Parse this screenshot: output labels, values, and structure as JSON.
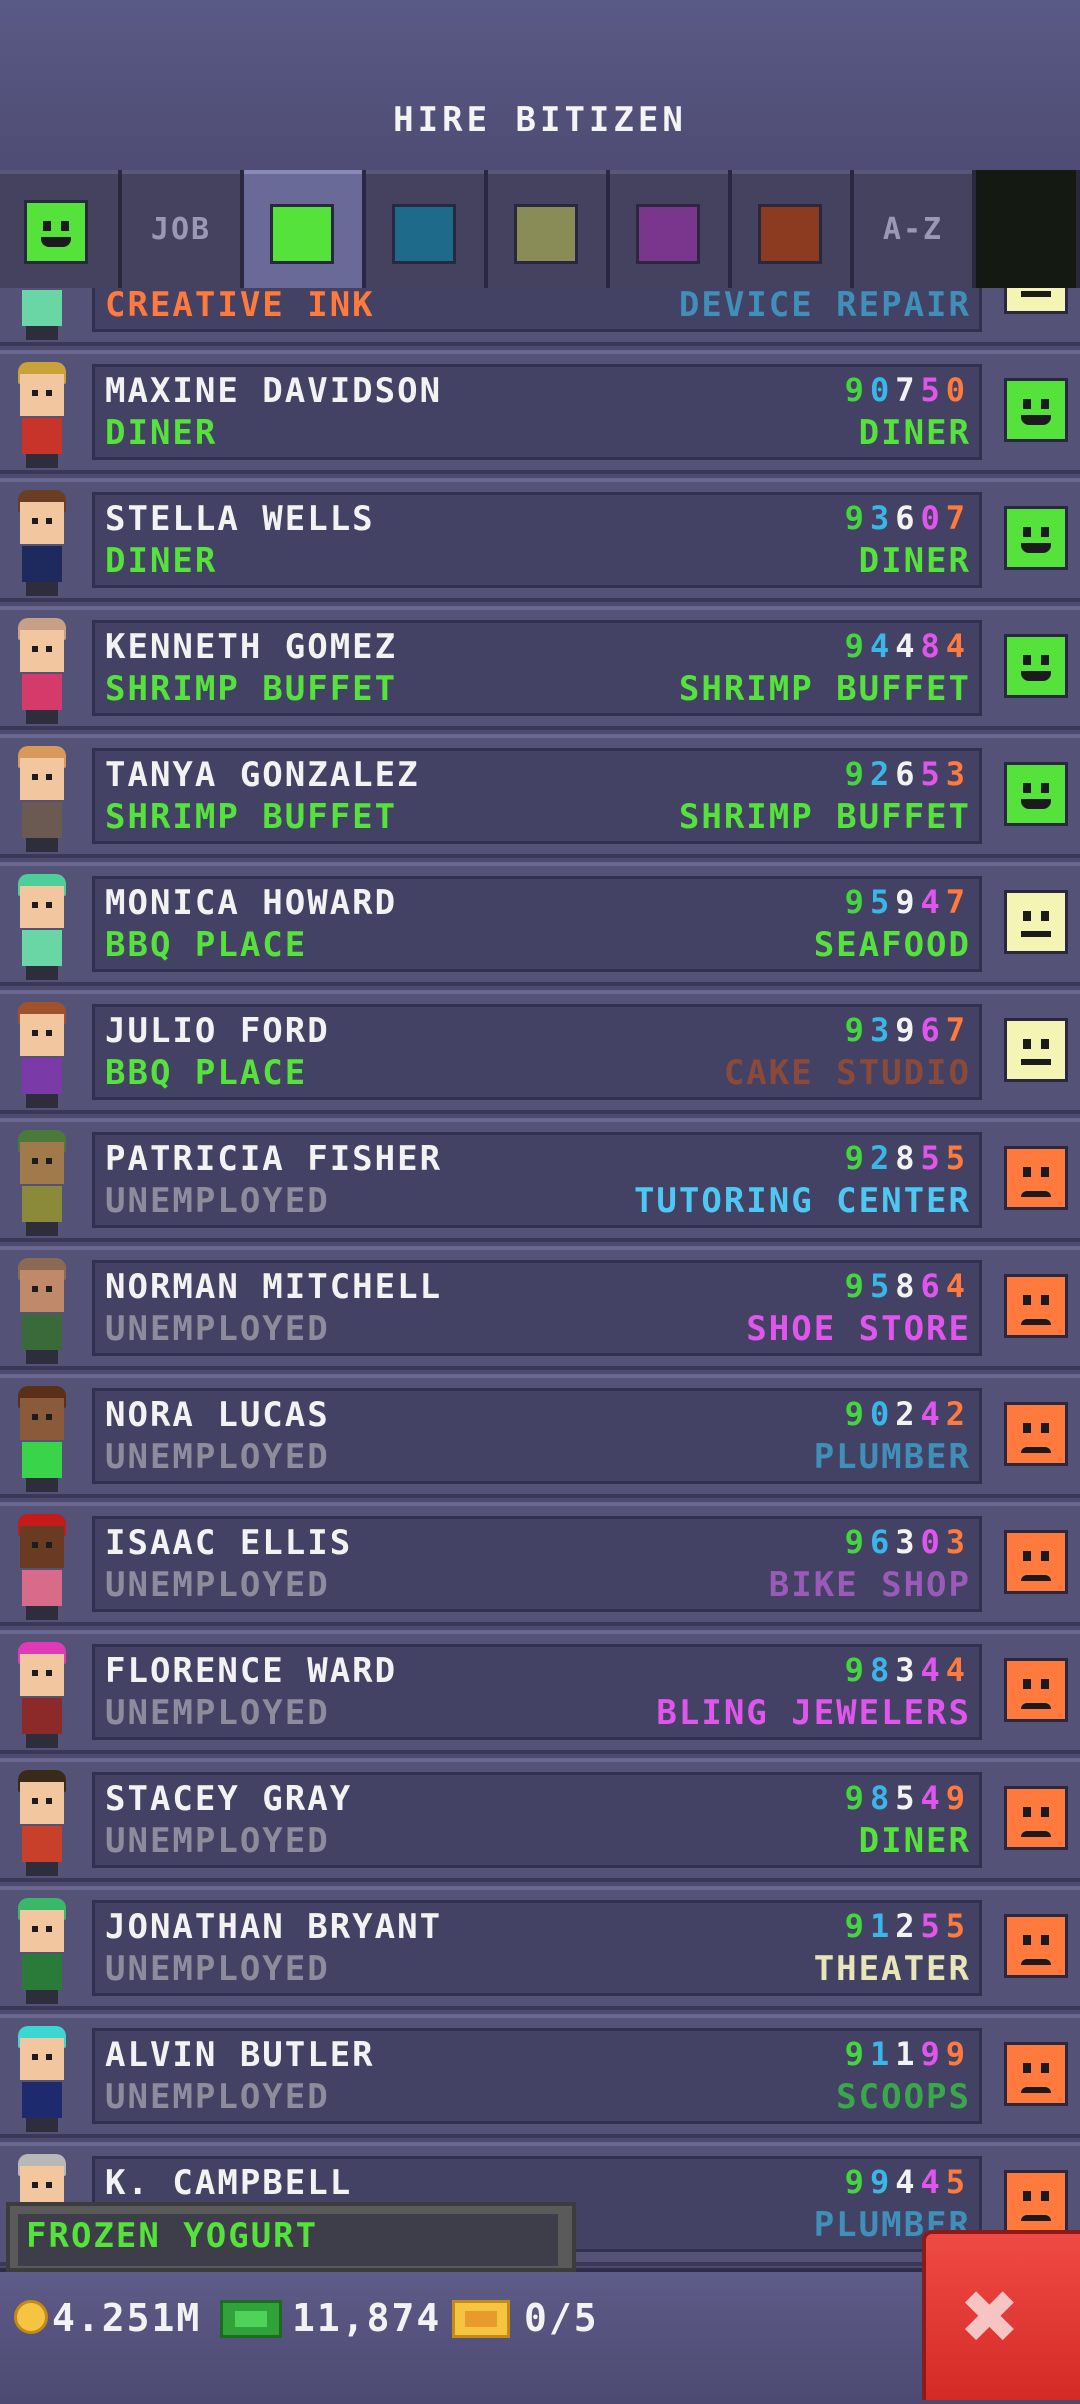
{
  "header": {
    "title": "HIRE BITIZEN"
  },
  "tabs": [
    {
      "kind": "face",
      "mood": "happy",
      "color": "#55e23b",
      "icon": "happy-face-icon"
    },
    {
      "kind": "text",
      "label": "JOB"
    },
    {
      "kind": "swatch",
      "color": "#55e23b",
      "active": true
    },
    {
      "kind": "swatch",
      "color": "#1e6a8a"
    },
    {
      "kind": "swatch",
      "color": "#8a8c58"
    },
    {
      "kind": "swatch",
      "color": "#7a368c"
    },
    {
      "kind": "swatch",
      "color": "#8c3a20"
    },
    {
      "kind": "text",
      "label": "A-Z"
    },
    {
      "kind": "dark"
    }
  ],
  "list": {
    "partial_top": {
      "current": "CREATIVE INK",
      "current_color": "#ff7a3c",
      "dream": "DEVICE REPAIR",
      "dream_color": "#3f8fb8",
      "mood": "neutral"
    },
    "rows": [
      {
        "name": "MAXINE DAVIDSON",
        "number": "90750",
        "current": "DINER",
        "current_color": "#55e23b",
        "dream": "DINER",
        "dream_color": "#55e23b",
        "mood": "happy",
        "hair": "#c9a23a",
        "skin": "#f2c7a0",
        "shirt": "#c8332a"
      },
      {
        "name": "STELLA WELLS",
        "number": "93607",
        "current": "DINER",
        "current_color": "#55e23b",
        "dream": "DINER",
        "dream_color": "#55e23b",
        "mood": "happy",
        "hair": "#6b3d22",
        "skin": "#f2c7a0",
        "shirt": "#1e2a5e"
      },
      {
        "name": "KENNETH GOMEZ",
        "number": "94484",
        "current": "SHRIMP BUFFET",
        "current_color": "#55e23b",
        "dream": "SHRIMP BUFFET",
        "dream_color": "#55e23b",
        "mood": "happy",
        "hair": "#c8a088",
        "skin": "#f2c7a0",
        "shirt": "#d43a6a"
      },
      {
        "name": "TANYA GONZALEZ",
        "number": "92653",
        "current": "SHRIMP BUFFET",
        "current_color": "#55e23b",
        "dream": "SHRIMP BUFFET",
        "dream_color": "#55e23b",
        "mood": "happy",
        "hair": "#d89a5a",
        "skin": "#f2c7a0",
        "shirt": "#6a5a52"
      },
      {
        "name": "MONICA HOWARD",
        "number": "95947",
        "current": "BBQ PLACE",
        "current_color": "#55e23b",
        "dream": "SEAFOOD",
        "dream_color": "#55e23b",
        "mood": "neutral",
        "hair": "#4ecf9a",
        "skin": "#f2c7a0",
        "shirt": "#6ad6a6"
      },
      {
        "name": "JULIO FORD",
        "number": "93967",
        "current": "BBQ PLACE",
        "current_color": "#55e23b",
        "dream": "CAKE STUDIO",
        "dream_color": "#8a4a3a",
        "mood": "neutral",
        "hair": "#a0522d",
        "skin": "#f2c7a0",
        "shirt": "#7a3aa8"
      },
      {
        "name": "PATRICIA FISHER",
        "number": "92855",
        "current": "UNEMPLOYED",
        "current_color": "#8c8c9c",
        "dream": "TUTORING CENTER",
        "dream_color": "#4ec8f2",
        "mood": "sad",
        "hair": "#4a7a3a",
        "skin": "#a07a4a",
        "shirt": "#8a8a3a"
      },
      {
        "name": "NORMAN MITCHELL",
        "number": "95864",
        "current": "UNEMPLOYED",
        "current_color": "#8c8c9c",
        "dream": "SHOE STORE",
        "dream_color": "#e056ec",
        "mood": "sad",
        "hair": "#8a6a52",
        "skin": "#c08a6a",
        "shirt": "#3a6a3a"
      },
      {
        "name": "NORA LUCAS",
        "number": "90242",
        "current": "UNEMPLOYED",
        "current_color": "#8c8c9c",
        "dream": "PLUMBER",
        "dream_color": "#3f8fb8",
        "mood": "sad",
        "hair": "#5a3018",
        "skin": "#8a5a3a",
        "shirt": "#3ad44a"
      },
      {
        "name": "ISAAC ELLIS",
        "number": "96303",
        "current": "UNEMPLOYED",
        "current_color": "#8c8c9c",
        "dream": "BIKE SHOP",
        "dream_color": "#9a5ab8",
        "mood": "sad",
        "hair": "#c41a1a",
        "skin": "#6a3a22",
        "shirt": "#d86a8a"
      },
      {
        "name": "FLORENCE WARD",
        "number": "98344",
        "current": "UNEMPLOYED",
        "current_color": "#8c8c9c",
        "dream": "BLING JEWELERS",
        "dream_color": "#e056ec",
        "mood": "sad",
        "hair": "#e03ab8",
        "skin": "#f2c7a0",
        "shirt": "#8c2a2a"
      },
      {
        "name": "STACEY GRAY",
        "number": "98549",
        "current": "UNEMPLOYED",
        "current_color": "#8c8c9c",
        "dream": "DINER",
        "dream_color": "#55e23b",
        "mood": "sad",
        "hair": "#3a2a1a",
        "skin": "#f2c7a0",
        "shirt": "#c8402a"
      },
      {
        "name": "JONATHAN BRYANT",
        "number": "91255",
        "current": "UNEMPLOYED",
        "current_color": "#8c8c9c",
        "dream": "THEATER",
        "dream_color": "#e8e6b8",
        "mood": "sad",
        "hair": "#3ab86a",
        "skin": "#f2c7a0",
        "shirt": "#2a7a3a"
      },
      {
        "name": "ALVIN BUTLER",
        "number": "91199",
        "current": "UNEMPLOYED",
        "current_color": "#8c8c9c",
        "dream": "SCOOPS",
        "dream_color": "#3aa84a",
        "mood": "sad",
        "hair": "#3ad8d0",
        "skin": "#f2c7a0",
        "shirt": "#1e2a6e"
      },
      {
        "name": "K. CAMPBELL",
        "number": "99445",
        "current": "",
        "current_color": "#8c8c9c",
        "dream": "PLUMBER",
        "dream_color": "#3f8fb8",
        "mood": "sad",
        "hair": "#b8b8b8",
        "skin": "#f2c7a0",
        "shirt": "#5a5a7a"
      }
    ]
  },
  "status_bar": {
    "label": "FROZEN YOGURT"
  },
  "footer": {
    "coins": "4.251M",
    "bux": "11,874",
    "tickets": "0/5"
  },
  "moods": {
    "happy": "#55e23b",
    "neutral": "#f4f4b4",
    "sad": "#ff7a3c"
  }
}
